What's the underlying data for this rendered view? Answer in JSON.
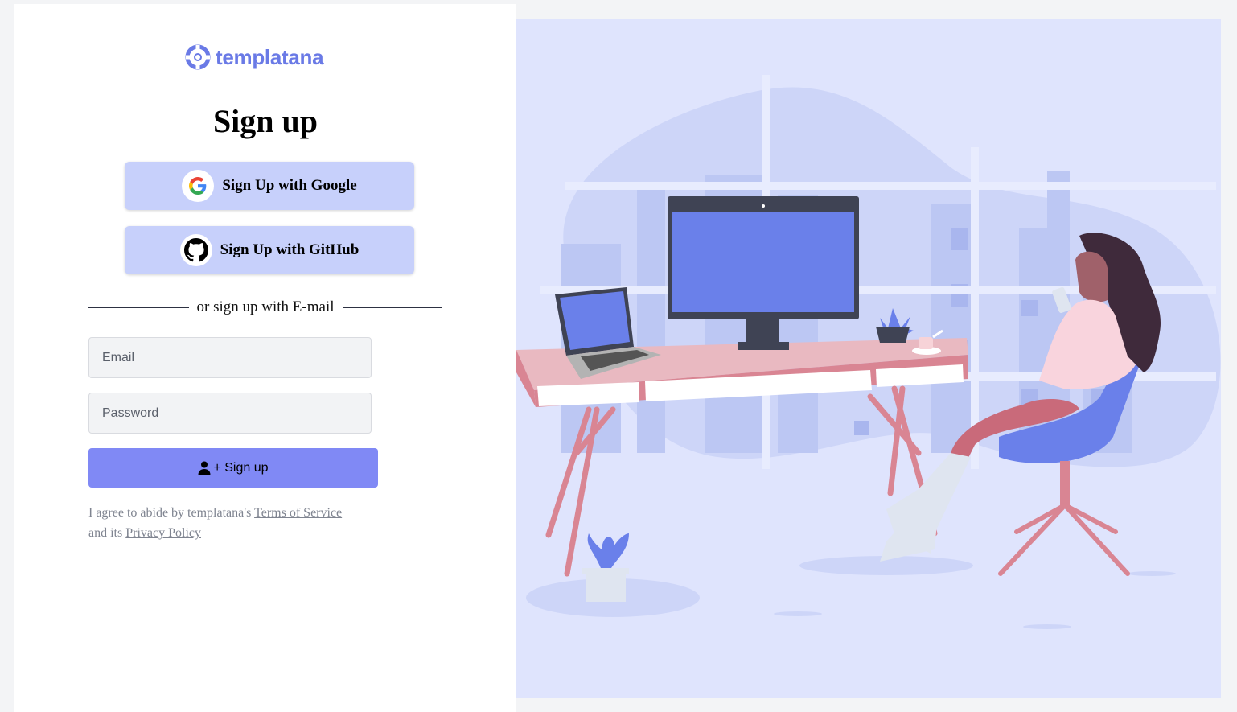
{
  "brand": {
    "name": "templatana"
  },
  "page": {
    "title": "Sign up"
  },
  "oauth": {
    "google_label": "Sign Up with Google",
    "github_label": "Sign Up with GitHub"
  },
  "divider": {
    "text": "or sign up with E-mail"
  },
  "form": {
    "email_placeholder": "Email",
    "password_placeholder": "Password",
    "submit_label": "+ Sign up",
    "submit_icon": "user-icon"
  },
  "terms": {
    "prefix": "I agree to abide by templatana's",
    "tos_link": "Terms of Service",
    "middle": "and its",
    "privacy_link": "Privacy Policy"
  },
  "colors": {
    "brand": "#6a7ae6",
    "oauth_button": "#c7d0fb",
    "submit_button": "#8089f5",
    "illustration_bg": "#dfe4fd"
  }
}
